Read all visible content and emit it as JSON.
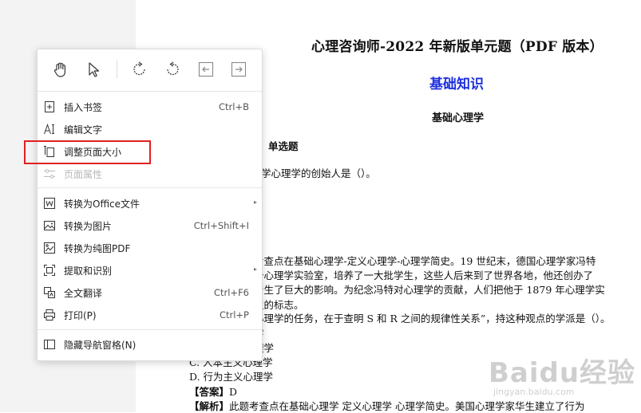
{
  "document": {
    "title": "心理咨询师-2022 年新版单元题（PDF 版本）",
    "section": "基础知识",
    "subsection": "基础心理学",
    "lines": [
      "题】单选题",
      "学心理学的创始人是（）。",
      "考查点在基础心理学-定义心理学-心理学简史。19 世纪末，德国心理学家冯特",
      "个心理学实验室，培养了一大批学生，这些人后来到了世界各地，他还创办了",
      "产生了巨大的影响。为纪念冯特对心理学的贡献，人们把他于 1879 年心理学实",
      "生的标志。",
      "心理学的任务，在于查明 S 和 R 之间的规律性关系”，持这种观点的学派是（）。",
      "学",
      "理学",
      "C. 人本主义心理学",
      "D. 行为主义心理学"
    ],
    "answer_label": "【答案】",
    "answer_value": "D",
    "analysis_label": "【解析】",
    "analysis_text": "此题考查点在基础心理学 定义心理学 心理学简史。美国心理学家华生建立了行为"
  },
  "watermark": {
    "brand": "Baidu经验",
    "url": "jingyan.baidu.com"
  },
  "context_menu": {
    "toolbar_icons": [
      "hand-tool-icon",
      "select-cursor-icon",
      "rotate-clockwise-icon",
      "rotate-counterclockwise-icon",
      "previous-page-icon",
      "next-page-icon"
    ],
    "items": [
      {
        "label": "插入书签",
        "shortcut": "Ctrl+B",
        "icon": "bookmark-add-icon"
      },
      {
        "label": "编辑文字",
        "shortcut": "",
        "icon": "edit-text-icon"
      },
      {
        "label": "调整页面大小",
        "shortcut": "",
        "icon": "resize-page-icon"
      },
      {
        "label": "页面属性",
        "shortcut": "",
        "icon": "page-properties-icon",
        "disabled": true
      },
      {
        "label": "转换为Office文件",
        "shortcut": "",
        "icon": "convert-office-icon",
        "submenu": true
      },
      {
        "label": "转换为图片",
        "shortcut": "Ctrl+Shift+I",
        "icon": "convert-image-icon"
      },
      {
        "label": "转换为纯图PDF",
        "shortcut": "",
        "icon": "image-pdf-icon"
      },
      {
        "label": "提取和识别",
        "shortcut": "",
        "icon": "extract-ocr-icon",
        "submenu": true
      },
      {
        "label": "全文翻译",
        "shortcut": "Ctrl+F6",
        "icon": "translate-icon"
      },
      {
        "label": "打印(P)",
        "shortcut": "Ctrl+P",
        "icon": "print-icon"
      },
      {
        "label": "隐藏导航窗格(N)",
        "shortcut": "",
        "icon": "hide-nav-pane-icon"
      }
    ]
  },
  "colors": {
    "highlight_border": "#e02020",
    "section_blue": "#1d2fe0"
  }
}
